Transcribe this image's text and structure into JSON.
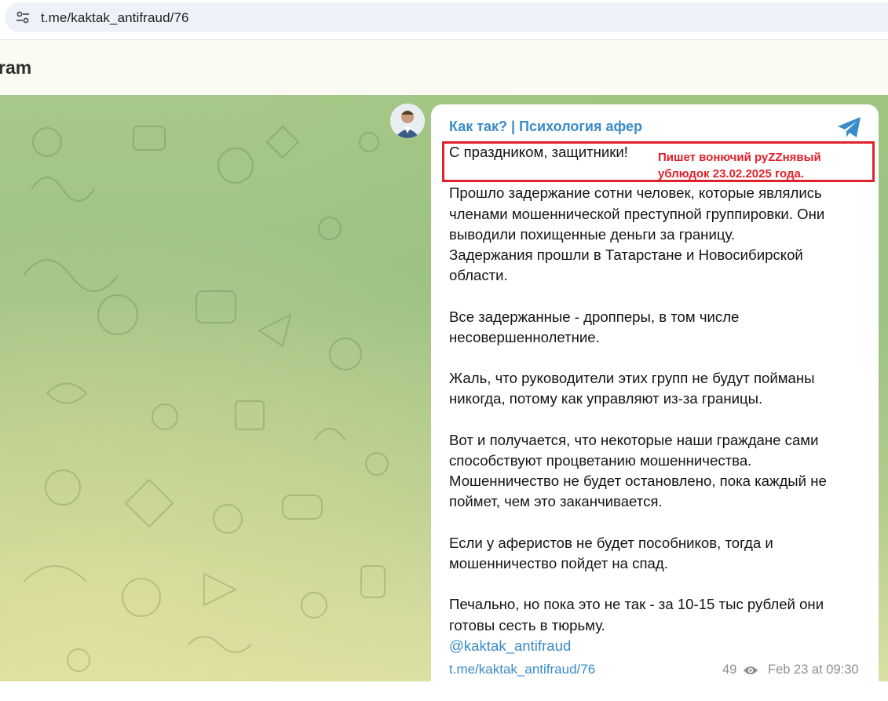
{
  "browser": {
    "url": "t.me/kaktak_antifraud/76",
    "site_info_icon": "tune-icon"
  },
  "header": {
    "title": "ram"
  },
  "message": {
    "channel_name": "Как так? | Психология афер",
    "logo_icon": "telegram-logo-icon",
    "lines": [
      "С праздником, защитники!",
      "",
      "Прошло задержание сотни человек, которые являлись членами мошеннической преступной группировки. Они выводили похищенные деньги за границу.",
      "Задержания прошли в Татарстане и Новосибирской области.",
      "",
      "Все задержанные - дропперы, в том числе несовершеннолетние.",
      "",
      "Жаль, что руководители этих групп не будут пойманы никогда, потому как управляют из-за границы.",
      "",
      "Вот и получается, что некоторые наши граждане сами способствуют процветанию мошенничества.",
      "Мошенничество не будет остановлено, пока каждый не поймет, чем это заканчивается.",
      "",
      "Если у аферистов не будет пособников, тогда и мошенничество пойдет на спад.",
      "",
      "Печально, но пока это не так - за 10-15 тыс рублей они готовы сесть в тюрьму."
    ],
    "mention": "@kaktak_antifraud",
    "footer_link": "t.me/kaktak_antifraud/76",
    "views": "49",
    "date": "Feb 23 at 09:30"
  },
  "annotation": {
    "line1": "Пишет вонючий руZZнявый",
    "line2": "ублюдок 23.02.2025 года.",
    "color": "#e0202a"
  },
  "colors": {
    "link": "#3a8bc9",
    "meta": "#8a8f93"
  }
}
